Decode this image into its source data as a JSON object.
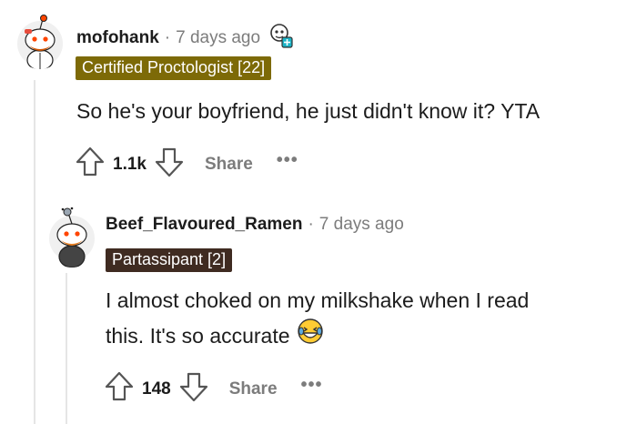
{
  "comments": [
    {
      "username": "mofohank",
      "separator": "·",
      "time": "7 days ago",
      "badge_icon": "award-badge-icon",
      "flair": "Certified Proctologist [22]",
      "flair_color": "#7d6a07",
      "body": "So he's your boyfriend, he just didn't know it? YTA",
      "votes": "1.1k",
      "share": "Share",
      "more": "•••"
    },
    {
      "username": "Beef_Flavoured_Ramen",
      "separator": "·",
      "time": "7 days ago",
      "flair": "Partassipant [2]",
      "flair_color": "#3f2b21",
      "body_line1": "I almost choked on my milkshake when I read",
      "body_line2": "this. It's so accurate",
      "emoji": "laughing-emoji-icon",
      "votes": "148",
      "share": "Share",
      "more": "•••"
    }
  ]
}
